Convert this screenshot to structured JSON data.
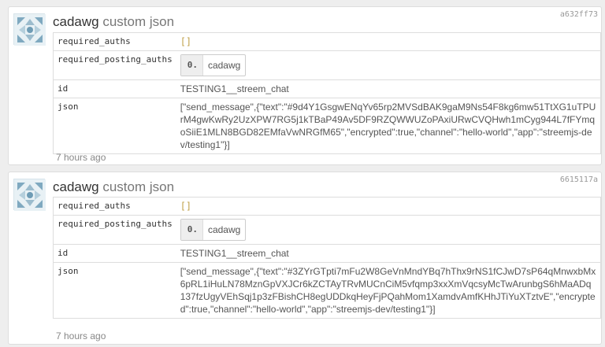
{
  "posts": [
    {
      "hash": "a632ff73",
      "author": "cadawg",
      "op_type": "custom json",
      "required_auths_label": "required_auths",
      "required_auths_value": "[]",
      "required_posting_auths_label": "required_posting_auths",
      "posting_index": "0.",
      "posting_account": "cadawg",
      "id_label": "id",
      "id_value": "TESTING1__streem_chat",
      "json_label": "json",
      "json_value": "[\"send_message\",{\"text\":\"#9d4Y1GsgwENqYv65rp2MVSdBAK9gaM9Ns54F8kg6mw51TtXG1uTPUrM4gwKwRy2UzXPW7RG5j1kTBaP49Av5DF9RZQWWUZoPAxiURwCVQHwh1mCyg944L7fFYmqoSiiE1MLN8BGD82EMfaVwNRGfM65\",\"encrypted\":true,\"channel\":\"hello-world\",\"app\":\"streemjs-dev/testing1\"}]",
      "time": "7 hours ago"
    },
    {
      "hash": "6615117a",
      "author": "cadawg",
      "op_type": "custom json",
      "required_auths_label": "required_auths",
      "required_auths_value": "[]",
      "required_posting_auths_label": "required_posting_auths",
      "posting_index": "0.",
      "posting_account": "cadawg",
      "id_label": "id",
      "id_value": "TESTING1__streem_chat",
      "json_label": "json",
      "json_value": "[\"send_message\",{\"text\":\"#3ZYrGTpti7mFu2W8GeVnMndYBq7hThx9rNS1fCJwD7sP64qMnwxbMx6pRL1iHuLN78MznGpVXJCr6kZCTAyTRvMUCnCiM5vfqmp3xxXmVqcsyMcTwArunbgS6hMaADq137fzUgyVEhSqj1p3zFBishCH8egUDDkqHeyFjPQahMom1XamdvAmfKHhJTiYuXTztvE\",\"encrypted\":true,\"channel\":\"hello-world\",\"app\":\"streemjs-dev/testing1\"}]",
      "time": "7 hours ago"
    }
  ]
}
